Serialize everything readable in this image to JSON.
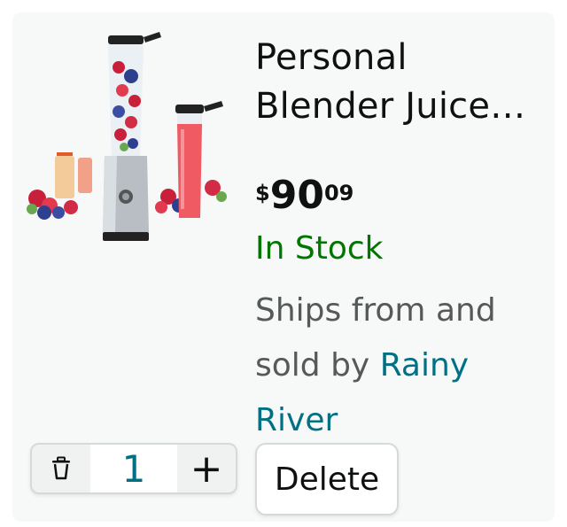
{
  "product": {
    "title": "Personal Blender Juice…",
    "price": {
      "symbol": "$",
      "whole": "90",
      "fraction": "09"
    },
    "stock": "In Stock",
    "ships_prefix": "Ships from and sold by ",
    "seller": "Rainy River",
    "image": "blender-product-image"
  },
  "cart": {
    "quantity": "1",
    "decrement_icon": "trash-icon",
    "increment_label": "+",
    "delete_label": "Delete"
  },
  "colors": {
    "stock": "#007600",
    "link": "#007185",
    "text": "#0f1111",
    "muted": "#565959"
  }
}
